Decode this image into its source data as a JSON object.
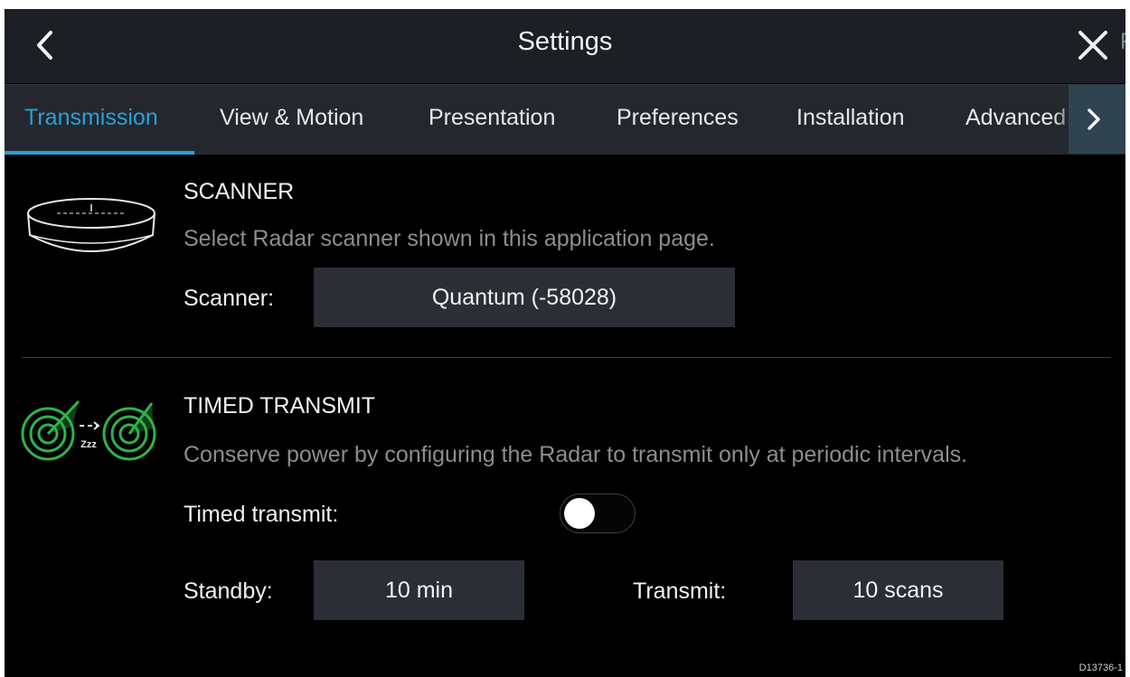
{
  "header": {
    "title": "Settings",
    "back_icon": "chevron-left-icon",
    "close_icon": "close-icon"
  },
  "tabs": [
    {
      "label": "Transmission",
      "active": true
    },
    {
      "label": "View & Motion",
      "active": false
    },
    {
      "label": "Presentation",
      "active": false
    },
    {
      "label": "Preferences",
      "active": false
    },
    {
      "label": "Installation",
      "active": false
    },
    {
      "label": "Advanced",
      "active": false
    }
  ],
  "tabs_partial_next": "R",
  "scanner": {
    "title": "SCANNER",
    "description": "Select Radar scanner shown in this application page.",
    "label": "Scanner:",
    "value": "Quantum (-58028)",
    "icon": "radar-scanner-icon"
  },
  "timed_transmit": {
    "title": "TIMED TRANSMIT",
    "description": "Conserve power by configuring the Radar to transmit only at periodic intervals.",
    "toggle_label": "Timed transmit:",
    "toggle_on": false,
    "standby_label": "Standby:",
    "standby_value": "10 min",
    "transmit_label": "Transmit:",
    "transmit_value": "10 scans",
    "icon": "radar-timed-icon",
    "icon_text": "Zzz"
  },
  "colors": {
    "accent": "#2a9fd8",
    "radar_green": "#2fb34a"
  },
  "reference_code": "D13736-1"
}
